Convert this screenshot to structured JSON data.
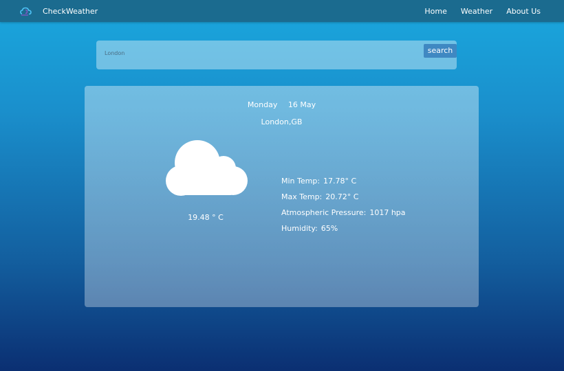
{
  "app": {
    "name": "CheckWeather",
    "logo_icon": "cloud-logo-icon"
  },
  "nav": {
    "items": [
      {
        "label": "Home"
      },
      {
        "label": "Weather"
      },
      {
        "label": "About Us"
      }
    ]
  },
  "search": {
    "value": "London",
    "button_label": "search"
  },
  "weather": {
    "day": "Monday",
    "date": "16 May",
    "location": "London,GB",
    "icon": "cloud-icon",
    "current_temp": "19.48 ° C",
    "details": [
      {
        "label": "Min Temp:",
        "value": "17.78° C"
      },
      {
        "label": "Max Temp:",
        "value": "20.72° C"
      },
      {
        "label": "Atmospheric Pressure:",
        "value": "1017 hpa"
      },
      {
        "label": "Humidity:",
        "value": "65%"
      }
    ]
  },
  "colors": {
    "navbar": "#1b6b8f",
    "accent": "#3f88c2",
    "gradient_top": "#1aa8de",
    "gradient_bottom": "#0b2f72"
  }
}
